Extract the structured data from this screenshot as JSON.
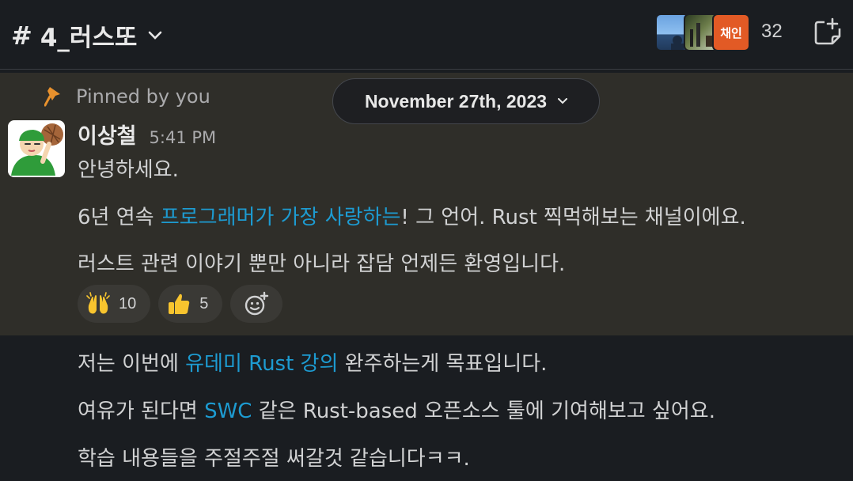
{
  "header": {
    "channel_hash": "#",
    "channel_name": "4_러스또",
    "member_count": "32",
    "member_avatar_label": "채인"
  },
  "pinned": {
    "label": "Pinned by you"
  },
  "date_divider": {
    "label": "November 27th, 2023"
  },
  "message": {
    "sender": "이상철",
    "time": "5:41 PM",
    "lines": {
      "l1": "안녕하세요.",
      "l2_pre": "6년 연속 ",
      "l2_link": "프로그래머가 가장 사랑하는",
      "l2_post": "! 그 언어. Rust 찍먹해보는 채널이에요.",
      "l3": "러스트 관련 이야기 뿐만 아니라 잡담 언제든 환영입니다.",
      "l4_pre": "저는 이번에 ",
      "l4_link": "유데미 Rust 강의",
      "l4_post": " 완주하는게 목표입니다.",
      "l5_pre": "여유가 된다면 ",
      "l5_link": "SWC",
      "l5_post": " 같은 Rust-based 오픈소스 툴에 기여해보고 싶어요.",
      "l6": "학습 내용들을 주절주절 써갈것 같습니다ㅋㅋ."
    }
  },
  "reactions": [
    {
      "emoji": "raised-hands",
      "count": "10"
    },
    {
      "emoji": "thumbs-up",
      "count": "5"
    }
  ],
  "colors": {
    "link": "#1d9bd1",
    "pinned_bg": "#2f2e29",
    "page_bg": "#1a1d21"
  }
}
